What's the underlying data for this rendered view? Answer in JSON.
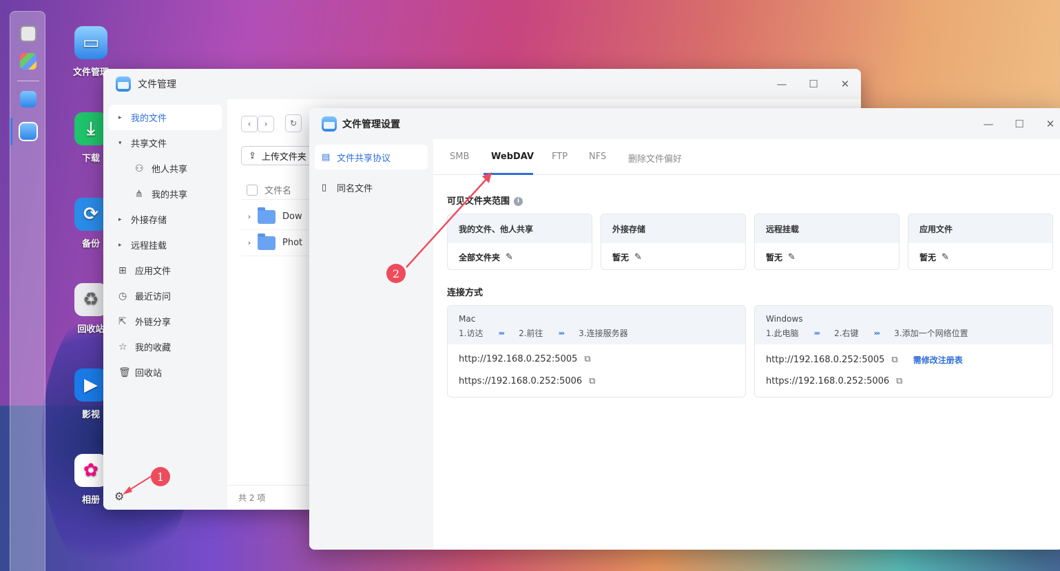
{
  "desktop": {
    "icons": [
      {
        "label": "文件管理",
        "icon": "folder-app-icon"
      },
      {
        "label": "下载",
        "icon": "download-icon"
      },
      {
        "label": "备份",
        "icon": "backup-icon"
      },
      {
        "label": "回收站",
        "icon": "recycle-icon"
      },
      {
        "label": "影视",
        "icon": "video-icon"
      },
      {
        "label": "相册",
        "icon": "photos-icon"
      }
    ]
  },
  "file_manager": {
    "title": "文件管理",
    "sidebar": {
      "my_files": "我的文件",
      "shared": "共享文件",
      "shared_by_others": "他人共享",
      "my_shares": "我的共享",
      "external": "外接存储",
      "remote": "远程挂载",
      "app_files": "应用文件",
      "recent": "最近访问",
      "link_share": "外链分享",
      "favorites": "我的收藏",
      "trash": "回收站"
    },
    "upload_label": "上传文件夹",
    "column_name": "文件名",
    "files": [
      "Dow",
      "Phot"
    ],
    "footer_count": "共 2 项"
  },
  "settings": {
    "title": "文件管理设置",
    "nav": [
      "文件共享协议",
      "同名文件"
    ],
    "tabs": [
      "SMB",
      "WebDAV",
      "FTP",
      "NFS",
      "删除文件偏好"
    ],
    "active_tab": "WebDAV",
    "visible_scope_title": "可见文件夹范围",
    "scope_cards": [
      {
        "header": "我的文件、他人共享",
        "value": "全部文件夹"
      },
      {
        "header": "外接存储",
        "value": "暂无"
      },
      {
        "header": "远程挂载",
        "value": "暂无"
      },
      {
        "header": "应用文件",
        "value": "暂无"
      }
    ],
    "connection_title": "连接方式",
    "mac": {
      "os": "Mac",
      "steps": [
        "1.访达",
        "2.前往",
        "3.连接服务器"
      ],
      "http": "http://192.168.0.252:5005",
      "https": "https://192.168.0.252:5006"
    },
    "windows": {
      "os": "Windows",
      "steps": [
        "1.此电脑",
        "2.右键",
        "3.添加一个网络位置"
      ],
      "http": "http://192.168.0.252:5005",
      "https": "https://192.168.0.252:5006",
      "registry_link": "需修改注册表"
    },
    "step_separator": "›››"
  },
  "annotations": {
    "badge1": "1",
    "badge2": "2",
    "color": "#ee4b5c"
  }
}
